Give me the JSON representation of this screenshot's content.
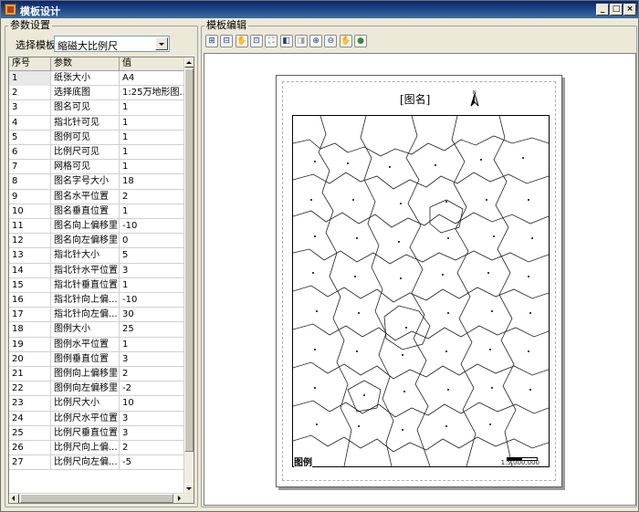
{
  "window": {
    "title": "模板设计",
    "buttons": {
      "minimize": "_",
      "maximize": "□",
      "close": "×"
    }
  },
  "params_group": {
    "title": "参数设置",
    "select_label": "选择模板",
    "template_value": "縮磁大比例尺"
  },
  "grid": {
    "headers": [
      "序号",
      "参数",
      "值"
    ],
    "rows": [
      [
        "1",
        "纸张大小",
        "A4"
      ],
      [
        "2",
        "选择底图",
        "1:25万地形图..."
      ],
      [
        "3",
        "图名可见",
        "1"
      ],
      [
        "4",
        "指北针可见",
        "1"
      ],
      [
        "5",
        "图例可见",
        "1"
      ],
      [
        "6",
        "比例尺可见",
        "1"
      ],
      [
        "7",
        "网格可见",
        "1"
      ],
      [
        "8",
        "图名字号大小",
        "18"
      ],
      [
        "9",
        "图名水平位置",
        "2"
      ],
      [
        "10",
        "图名垂直位置",
        "1"
      ],
      [
        "11",
        "图名向上偏移里",
        "-10"
      ],
      [
        "12",
        "图名向左偏移里",
        "0"
      ],
      [
        "13",
        "指北针大小",
        "5"
      ],
      [
        "14",
        "指北针水平位置",
        "3"
      ],
      [
        "15",
        "指北针垂直位置",
        "1"
      ],
      [
        "16",
        "指北针向上偏...",
        "-10"
      ],
      [
        "17",
        "指北针向左偏...",
        "30"
      ],
      [
        "18",
        "图例大小",
        "25"
      ],
      [
        "19",
        "图例水平位置",
        "1"
      ],
      [
        "20",
        "图例垂直位置",
        "3"
      ],
      [
        "21",
        "图例向上偏移里",
        "2"
      ],
      [
        "22",
        "图例向左偏移里",
        "-2"
      ],
      [
        "23",
        "比例尺大小",
        "10"
      ],
      [
        "24",
        "比例尺水平位置",
        "3"
      ],
      [
        "25",
        "比例尺垂直位置",
        "3"
      ],
      [
        "26",
        "比例尺向上偏...",
        "2"
      ],
      [
        "27",
        "比例尺向左偏...",
        "-5"
      ]
    ]
  },
  "editor_group": {
    "title": "模板编辑"
  },
  "toolbar": {
    "tools": [
      {
        "name": "zoom-extent-icon",
        "glyph": "⊞"
      },
      {
        "name": "zoom-layer-icon",
        "glyph": "⊟"
      },
      {
        "name": "pan-hand-icon",
        "glyph": "✋"
      },
      {
        "name": "fixed-zoom-icon",
        "glyph": "⊡"
      },
      {
        "name": "full-extent-icon",
        "glyph": "⛶"
      },
      {
        "name": "prev-view-icon",
        "glyph": "◧"
      },
      {
        "name": "next-view-icon",
        "glyph": "◨"
      },
      {
        "name": "zoom-in-icon",
        "glyph": "⊕"
      },
      {
        "name": "zoom-out-icon",
        "glyph": "⊖"
      },
      {
        "name": "hand-icon",
        "glyph": "✋"
      },
      {
        "name": "globe-icon",
        "glyph": "●"
      }
    ]
  },
  "layout_page": {
    "map_title": "[图名]",
    "north_label": "N",
    "legend_label": "图例",
    "scale_text": "1:5,000,000"
  },
  "colors": {
    "titlebar": "#0a246a",
    "window_bg": "#ece9d8",
    "globe": "#3a8a3a"
  }
}
